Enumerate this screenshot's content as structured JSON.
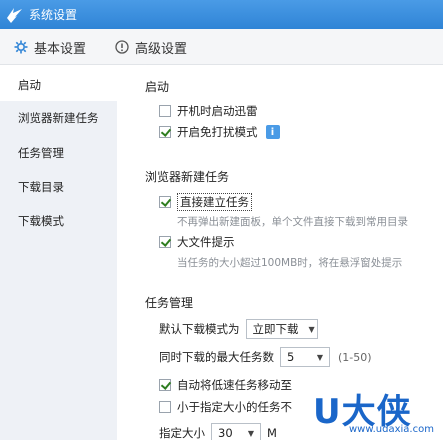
{
  "window": {
    "title": "系统设置"
  },
  "tabs": [
    {
      "label": "基本设置",
      "icon": "gear-icon"
    },
    {
      "label": "高级设置",
      "icon": "info-circle-icon"
    }
  ],
  "sidebar": {
    "items": [
      {
        "label": "启动",
        "active": true
      },
      {
        "label": "浏览器新建任务"
      },
      {
        "label": "任务管理"
      },
      {
        "label": "下载目录"
      },
      {
        "label": "下载模式"
      }
    ]
  },
  "startup": {
    "title": "启动",
    "auto_start_label": "开机时启动迅雷",
    "auto_start_checked": false,
    "dnd_label": "开启免打扰模式",
    "dnd_checked": true
  },
  "browser_task": {
    "title": "浏览器新建任务",
    "direct_label": "直接建立任务",
    "direct_checked": true,
    "direct_hint": "不再弹出新建面板，单个文件直接下载到常用目录",
    "bigfile_label": "大文件提示",
    "bigfile_checked": true,
    "bigfile_hint": "当任务的大小超过100MB时，将在悬浮窗处提示"
  },
  "task_mgmt": {
    "title": "任务管理",
    "default_mode_label": "默认下载模式为",
    "default_mode_value": "立即下载",
    "max_tasks_label": "同时下载的最大任务数",
    "max_tasks_value": "5",
    "max_tasks_range": "(1-50)",
    "auto_move_label": "自动将低速任务移动至",
    "auto_move_checked": true,
    "small_task_label": "小于指定大小的任务不",
    "small_task_checked": false,
    "size_label": "指定大小",
    "size_value": "30",
    "size_unit_cut": "M"
  },
  "watermark": {
    "big": "U大侠",
    "small": "www.udaxia.com"
  }
}
